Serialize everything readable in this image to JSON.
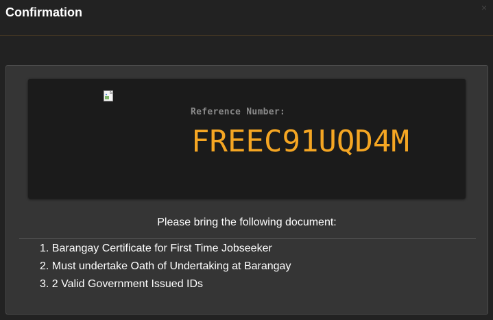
{
  "dialog": {
    "title": "Confirmation",
    "close_icon": "close-icon",
    "close_glyph": "×"
  },
  "reference": {
    "image_icon": "broken-image-icon",
    "label": "Reference Number:",
    "number": "FREEC91UQD4M"
  },
  "instructions": {
    "heading": "Please bring the following document:",
    "items": [
      "1. Barangay Certificate for First Time Jobseeker",
      "2. Must undertake Oath of Undertaking at Barangay",
      "3. 2 Valid Government Issued IDs"
    ]
  },
  "colors": {
    "accent": "#f5a623",
    "background": "#222222",
    "panel": "#353535",
    "card": "#1b1b1b"
  }
}
